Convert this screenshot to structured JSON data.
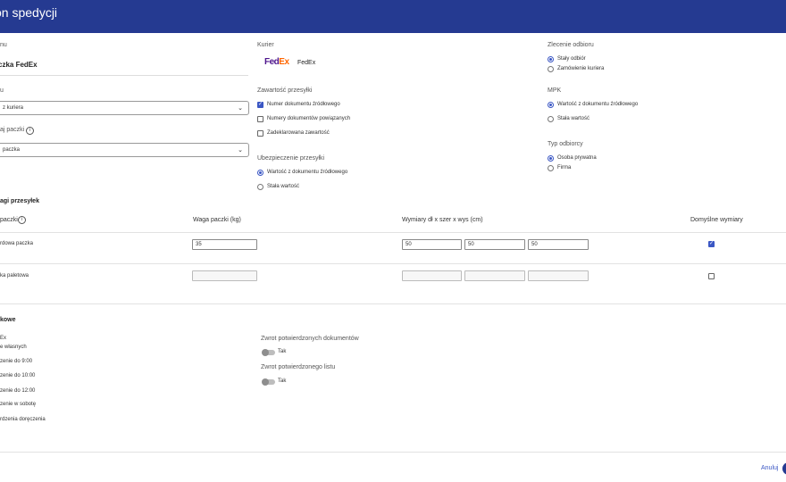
{
  "header": {
    "title": "on spedycji"
  },
  "left": {
    "name_label": "nu",
    "name_value": "czka FedEx",
    "type_label": "u",
    "type_value": "z kuriera",
    "package_label": "aj paczki",
    "package_value": "paczka"
  },
  "courier": {
    "label": "Kurier",
    "logo_fed": "Fed",
    "logo_ex": "Ex",
    "name": "FedEx"
  },
  "content": {
    "label": "Zawartość przesyłki",
    "options": [
      {
        "label": "Numer dokumentu źródłowego",
        "checked": true
      },
      {
        "label": "Numery dokumentów powiązanych",
        "checked": false
      },
      {
        "label": "Zadeklarowana zawartość",
        "checked": false
      }
    ]
  },
  "insurance": {
    "label": "Ubezpieczenie przesyłki",
    "options": [
      {
        "label": "Wartość z dokumentu źródłowego",
        "selected": true
      },
      {
        "label": "Stała wartość",
        "selected": false
      }
    ]
  },
  "pickup": {
    "label": "Zlecenie odbioru",
    "options": [
      {
        "label": "Stały odbiór",
        "selected": true
      },
      {
        "label": "Zamówienie kuriera",
        "selected": false
      }
    ]
  },
  "mpk": {
    "label": "MPK",
    "options": [
      {
        "label": "Wartość z dokumentu źródłowego",
        "selected": true
      },
      {
        "label": "Stała wartość",
        "selected": false
      }
    ]
  },
  "recipient": {
    "label": "Typ odbiorcy",
    "options": [
      {
        "label": "Osoba prywatna",
        "selected": true
      },
      {
        "label": "Firma",
        "selected": false
      }
    ]
  },
  "weights": {
    "section_title": "agi przesyłek",
    "col_package": "paczki",
    "col_weight": "Waga paczki (kg)",
    "col_dims": "Wymiary dł x szer x wys (cm)",
    "col_default": "Domyślne wymiary",
    "rows": [
      {
        "name": "rdowa paczka",
        "weight": "35",
        "length": "50",
        "width": "50",
        "height": "50",
        "default": true
      },
      {
        "name": "ka paletowa",
        "weight": "",
        "length": "",
        "width": "",
        "height": "",
        "default": false
      }
    ]
  },
  "extra": {
    "title": "kowe",
    "items": [
      "Ex",
      "e własnych",
      "zenie do 9:00",
      "zenie do 10:00",
      "zenie do 12:00",
      "zenie w sobotę",
      "rdzenia doręczenia"
    ],
    "returns": [
      {
        "label": "Zwrot potwierdzonych dokumentów",
        "toggle_label": "Tak"
      },
      {
        "label": "Zwrot potwierdzonego listu",
        "toggle_label": "Tak"
      }
    ]
  },
  "footer": {
    "cancel_label": "Anuluj"
  }
}
